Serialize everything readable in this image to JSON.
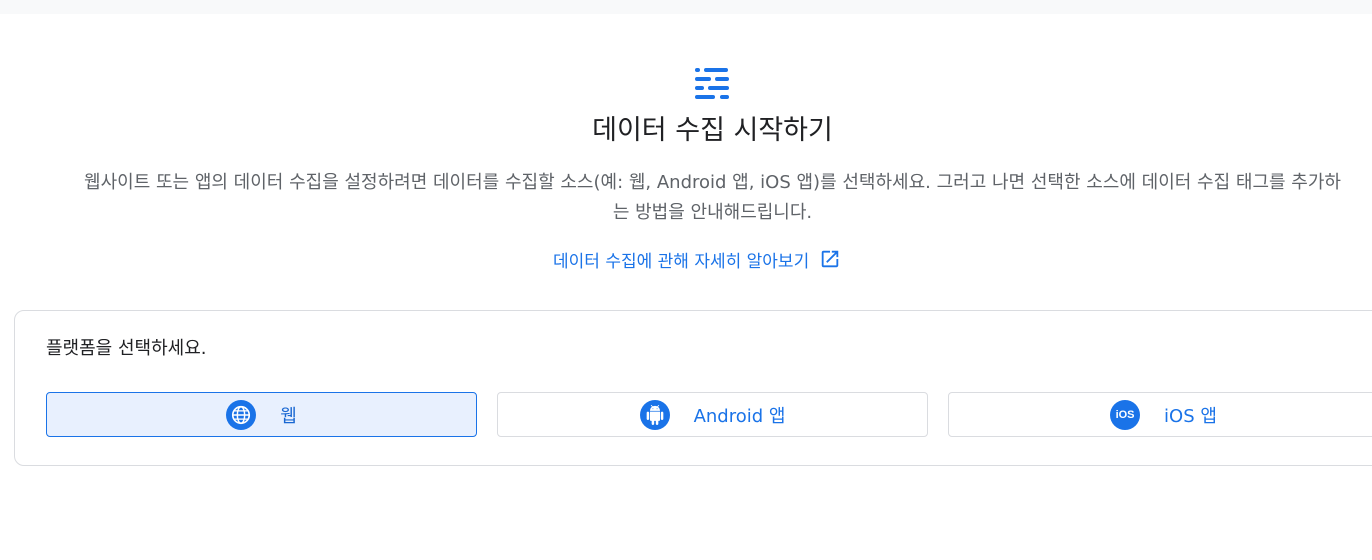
{
  "header": {
    "title": "데이터 수집 시작하기",
    "description": "웹사이트 또는 앱의 데이터 수집을 설정하려면 데이터를 수집할 소스(예: 웹, Android 앱, iOS 앱)를 선택하세요. 그러고 나면 선택한 소스에 데이터 수집 태그를 추가하는 방법을 안내해드립니다.",
    "learn_more": "데이터 수집에 관해 자세히 알아보기"
  },
  "platform": {
    "label": "플랫폼을 선택하세요.",
    "options": [
      {
        "label": "웹",
        "icon": "globe-icon",
        "selected": true
      },
      {
        "label": "Android 앱",
        "icon": "android-icon",
        "selected": false
      },
      {
        "label": "iOS 앱",
        "icon": "ios-icon",
        "selected": false
      }
    ]
  },
  "colors": {
    "accent": "#1a73e8",
    "selected_bg": "#e8f0fe",
    "border": "#dadce0"
  }
}
